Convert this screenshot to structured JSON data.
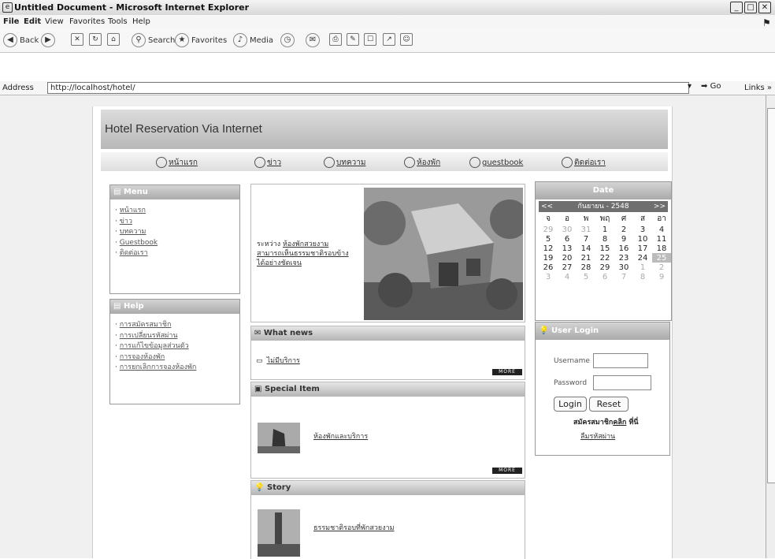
{
  "window": {
    "title": "Untitled Document - Microsoft Internet Explorer"
  },
  "menu": {
    "file": "File",
    "edit": "Edit",
    "view": "View",
    "favorites": "Favorites",
    "tools": "Tools",
    "help": "Help"
  },
  "toolbar": {
    "back": "Back",
    "search": "Search",
    "favorites": "Favorites",
    "media": "Media"
  },
  "address": {
    "label": "Address",
    "url": "http://localhost/hotel/",
    "go": "Go",
    "links": "Links »"
  },
  "site": {
    "title": "Hotel Reservation Via Internet",
    "nav": [
      "หน้าแรก",
      "ข่าว",
      "บทความ",
      "ห้องพัก",
      "guestbook",
      "ติดต่อเรา"
    ]
  },
  "menu_box": {
    "title": "Menu",
    "items": [
      "หน้าแรก",
      "ข่าว",
      "บทความ",
      "Guestbook",
      "ติดต่อเรา"
    ]
  },
  "info_box": {
    "title": "Help",
    "items": [
      "การสมัครสมาชิก",
      "การเปลี่ยนรหัสผ่าน",
      "การแก้ไขข้อมูลส่วนตัว",
      "การจองห้องพัก",
      "การยกเลิกการจองห้องพัก"
    ]
  },
  "hero": {
    "prefix": "ระหว่าง",
    "link": "ห้องพักสวยงาม",
    "lines": [
      "สามารถเห็นธรรมชาติรอบข้าง",
      "ได้อย่างชัดเจน"
    ]
  },
  "whatnews": {
    "title": "What news",
    "link": "ไม่มีบริการ",
    "more": "MORE"
  },
  "special": {
    "title": "Special Item",
    "link": "ห้องพักและบริการ",
    "more": "MORE"
  },
  "story": {
    "title": "Story",
    "link": "ธรรมชาติรอบที่พักสวยงาม"
  },
  "calendar": {
    "title": "Date",
    "prev": "<<",
    "month": "กันยายน - 2548",
    "next": ">>",
    "days": [
      "จ",
      "อ",
      "พ",
      "พฤ",
      "ศ",
      "ส",
      "อา"
    ],
    "weeks": [
      [
        "29",
        "30",
        "31",
        "1",
        "2",
        "3",
        "4"
      ],
      [
        "5",
        "6",
        "7",
        "8",
        "9",
        "10",
        "11"
      ],
      [
        "12",
        "13",
        "14",
        "15",
        "16",
        "17",
        "18"
      ],
      [
        "19",
        "20",
        "21",
        "22",
        "23",
        "24",
        "25"
      ],
      [
        "26",
        "27",
        "28",
        "29",
        "30",
        "1",
        "2"
      ],
      [
        "3",
        "4",
        "5",
        "6",
        "7",
        "8",
        "9"
      ]
    ]
  },
  "login": {
    "title": "User Login",
    "username_label": "Username",
    "password_label": "Password",
    "login_button": "Login",
    "reset_button": "Reset",
    "register_text": "สมัครสมาชิก",
    "register_link": "คลิก",
    "register_suffix": "ที่นี่",
    "forgot_link": "ลืมรหัสผ่าน"
  }
}
